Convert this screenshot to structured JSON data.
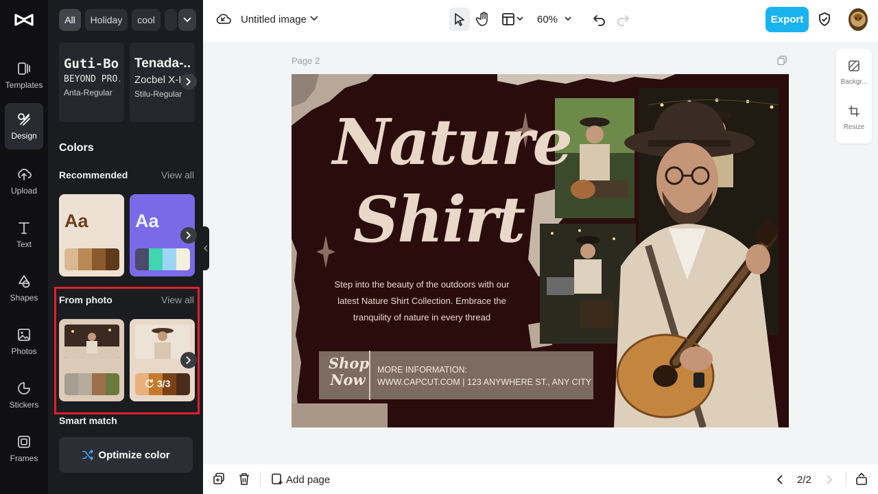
{
  "rail": {
    "items": [
      {
        "label": "Templates",
        "icon": "templates-icon"
      },
      {
        "label": "Design",
        "icon": "design-icon",
        "active": true
      },
      {
        "label": "Upload",
        "icon": "upload-icon"
      },
      {
        "label": "Text",
        "icon": "text-icon"
      },
      {
        "label": "Shapes",
        "icon": "shapes-icon"
      },
      {
        "label": "Photos",
        "icon": "photos-icon"
      },
      {
        "label": "Stickers",
        "icon": "stickers-icon"
      },
      {
        "label": "Frames",
        "icon": "frames-icon"
      }
    ]
  },
  "panel": {
    "chips": [
      "All",
      "Holiday",
      "cool"
    ],
    "fonts": [
      {
        "line1": "Guti-Bo...",
        "line2": "BEYOND PRO...",
        "line3": "Anta-Regular"
      },
      {
        "line1": "Tenada-...",
        "line2": "Zocbel X-I",
        "line3": "Stilu-Regular"
      }
    ],
    "colors_title": "Colors",
    "recommended_title": "Recommended",
    "view_all": "View all",
    "recommended_cards": [
      {
        "aa": "Aa",
        "swatches": [
          "#d9b993",
          "#b98a55",
          "#8a5a2c",
          "#5e3a1c"
        ]
      },
      {
        "aa": "Aa",
        "swatches": [
          "#4a4a6a",
          "#3fd6b0",
          "#9bd7f5",
          "#f3f0dc"
        ]
      }
    ],
    "from_photo_title": "From photo",
    "from_photo_cards": [
      {
        "swatches": [
          "#a79e92",
          "#b7ab9c",
          "#9c6e4a",
          "#6c7a3c"
        ]
      },
      {
        "swatches": [
          "#e8b07a",
          "#c47a2c",
          "#7a4214",
          "#4a2c1c"
        ],
        "badge": "3/3"
      }
    ],
    "smart_match_title": "Smart match",
    "optimize_label": "Optimize color"
  },
  "topbar": {
    "doc_title": "Untitled image",
    "zoom": "60%",
    "export_label": "Export"
  },
  "canvas": {
    "page_label": "Page 2",
    "headline_1": "Nature",
    "headline_2": "Shirt",
    "body": "Step into the beauty of the outdoors with our latest Nature Shirt Collection. Embrace the tranquility of nature in every thread",
    "shop_1": "Shop",
    "shop_2": "Now",
    "more_info": "MORE INFORMATION:",
    "contact": "WWW.CAPCUT.COM | 123 ANYWHERE ST., ANY CITY"
  },
  "mini_panel": {
    "background_label": "Backgr...",
    "resize_label": "Resize"
  },
  "bottombar": {
    "add_page_label": "Add page",
    "page_counter": "2/2"
  }
}
